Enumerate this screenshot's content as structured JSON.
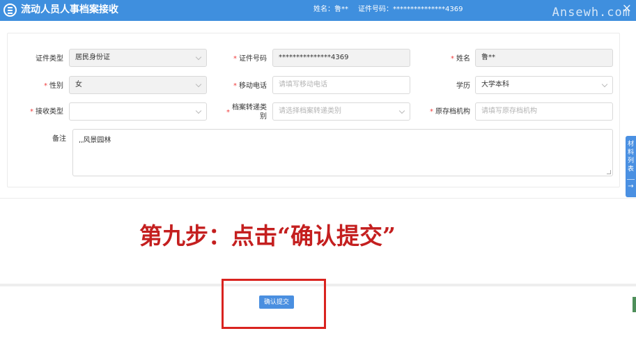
{
  "header": {
    "title": "流动人员人事档案接收",
    "name_text": "姓名：鲁**",
    "id_text": "证件号码：***************4369",
    "watermark": "Ansewh.com",
    "close_symbol": "×"
  },
  "form": {
    "id_type": {
      "label": "证件类型",
      "value": "居民身份证"
    },
    "id_number": {
      "label": "证件号码",
      "value": "***************4369"
    },
    "name": {
      "label": "姓名",
      "value": "鲁**"
    },
    "gender": {
      "label": "性别",
      "value": "女"
    },
    "mobile": {
      "label": "移动电话",
      "placeholder": "请填写移动电话"
    },
    "education": {
      "label": "学历",
      "value": "大学本科"
    },
    "receive_type": {
      "label": "接收类型",
      "value": ""
    },
    "transfer_category": {
      "label": "档案转递类别",
      "placeholder": "请选择档案转递类别"
    },
    "original_archive_org": {
      "label": "原存档机构",
      "placeholder": "请填写原存档机构"
    },
    "remarks": {
      "label": "备注",
      "value": ",,风景园林"
    }
  },
  "required_mark": "*",
  "side_tab": {
    "text": "材料列表",
    "arrow": "→"
  },
  "instruction": "第九步：点击“确认提交”",
  "submit_button": "确认提交"
}
